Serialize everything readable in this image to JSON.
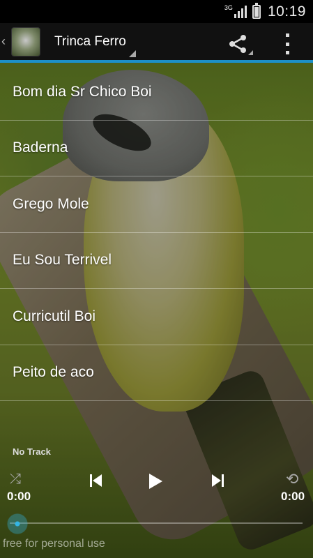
{
  "status_bar": {
    "network": "3G",
    "time": "10:19"
  },
  "action_bar": {
    "title": "Trinca Ferro",
    "icons": [
      "back-chevron-icon",
      "app-logo-icon",
      "share-icon",
      "overflow-menu-icon"
    ]
  },
  "tracks": [
    "Bom dia Sr Chico Boi",
    "Baderna",
    "Grego Mole",
    "Eu Sou Terrivel",
    "Curricutil Boi",
    "Peito de aco"
  ],
  "player": {
    "current_track": "No Track",
    "elapsed": "0:00",
    "duration": "0:00",
    "progress": 0,
    "accent_color": "#33b5e5",
    "icons": [
      "shuffle-icon",
      "previous-icon",
      "play-icon",
      "next-icon",
      "repeat-icon"
    ]
  },
  "footer": {
    "note": "free for personal use"
  },
  "colors": {
    "action_bar_underline": "#1c90c9",
    "seek_accent": "#33b5e5"
  }
}
